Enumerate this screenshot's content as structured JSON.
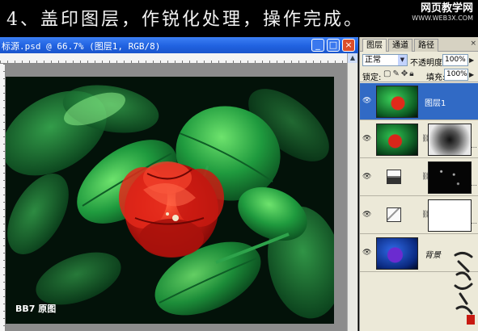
{
  "banner": {
    "title": "4、盖印图层，作锐化处理，操作完成。",
    "watermark_name": "网页教学网",
    "watermark_url": "WWW.WEB3X.COM"
  },
  "document": {
    "title": "标源.psd @ 66.7% (图层1, RGB/8)",
    "canvas_label": "BB7 原图",
    "buttons": {
      "minimize": "_",
      "maximize": "□",
      "close": "×"
    }
  },
  "layers_panel": {
    "tabs": [
      "图层",
      "通道",
      "路径"
    ],
    "tab_close": "×",
    "blend_mode": "正常",
    "opacity_label": "不透明度:",
    "opacity_value": "100%",
    "lock_label": "锁定:",
    "fill_label": "填充:",
    "fill_value": "100%",
    "layers": [
      {
        "name": "图层1",
        "selected": true
      },
      {
        "name": "",
        "selected": false
      },
      {
        "name": "",
        "selected": false
      },
      {
        "name": "",
        "selected": false
      },
      {
        "name": "背景",
        "selected": false
      }
    ]
  },
  "colors": {
    "title_bar": "#2062e0",
    "selected_layer": "#316ac5",
    "panel_bg": "#ece9d8",
    "flower_red": "#c81a12",
    "leaf_green": "#1f9a3e"
  },
  "icons": [
    "eye-icon",
    "link-icon",
    "lock-icon",
    "brush-icon",
    "move-icon",
    "adjustment-layer-icon",
    "close-icon",
    "dropdown-arrow-icon"
  ]
}
